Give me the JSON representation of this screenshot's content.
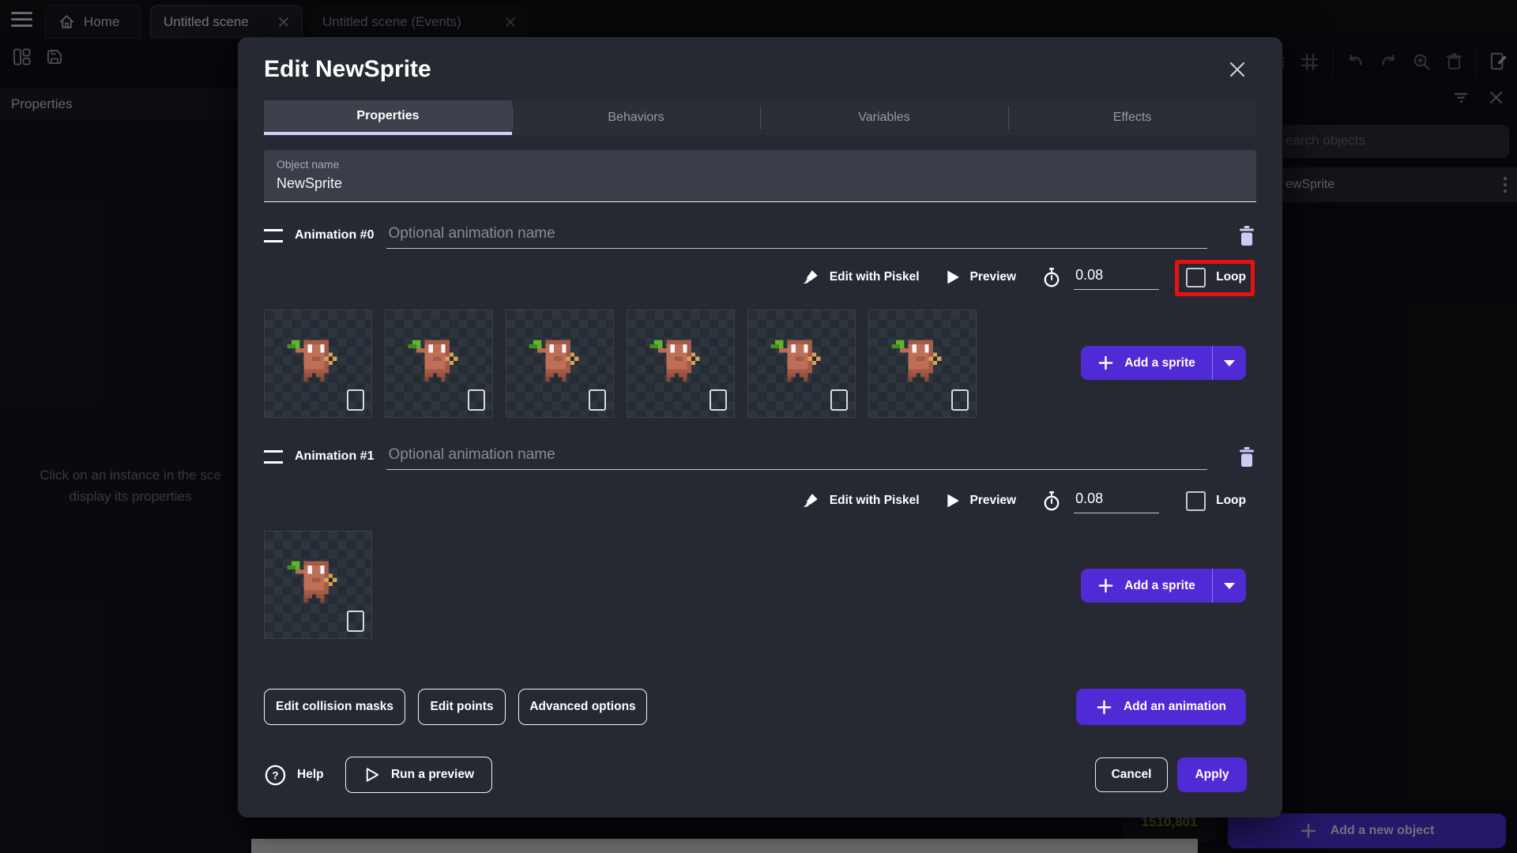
{
  "window": {
    "tabs": {
      "home": "Home",
      "scene": "Untitled scene",
      "events": "Untitled scene (Events)"
    },
    "left_panel": {
      "title": "Properties",
      "hint_line1": "Click on an instance in the sce",
      "hint_line2": "display its properties"
    },
    "right_panel": {
      "search_placeholder": "earch objects",
      "object_item": "ewSprite",
      "coordinates": "1510,801",
      "add_object": "Add a new object"
    }
  },
  "dialog": {
    "title": "Edit NewSprite",
    "tabs": {
      "properties": "Properties",
      "behaviors": "Behaviors",
      "variables": "Variables",
      "effects": "Effects"
    },
    "object_name_label": "Object name",
    "object_name_value": "NewSprite",
    "animations": [
      {
        "label": "Animation #0",
        "name_placeholder": "Optional animation name",
        "piskel_label": "Edit with Piskel",
        "preview_label": "Preview",
        "frame_duration": "0.08",
        "loop_label": "Loop",
        "frame_count": 6
      },
      {
        "label": "Animation #1",
        "name_placeholder": "Optional animation name",
        "piskel_label": "Edit with Piskel",
        "preview_label": "Preview",
        "frame_duration": "0.08",
        "loop_label": "Loop",
        "frame_count": 1
      }
    ],
    "add_sprite_label": "Add a sprite",
    "actions": {
      "collision_masks": "Edit collision masks",
      "points": "Edit points",
      "advanced": "Advanced options",
      "add_animation": "Add an animation"
    },
    "footer": {
      "help": "Help",
      "run_preview": "Run a preview",
      "cancel": "Cancel",
      "apply": "Apply"
    }
  },
  "colors": {
    "accent": "#4f2ad5",
    "loop_highlight": "#e81010",
    "active_tab_underline": "#d6cdf6",
    "dialog_background": "#262932",
    "trash_icon": "#cfc8f3"
  }
}
